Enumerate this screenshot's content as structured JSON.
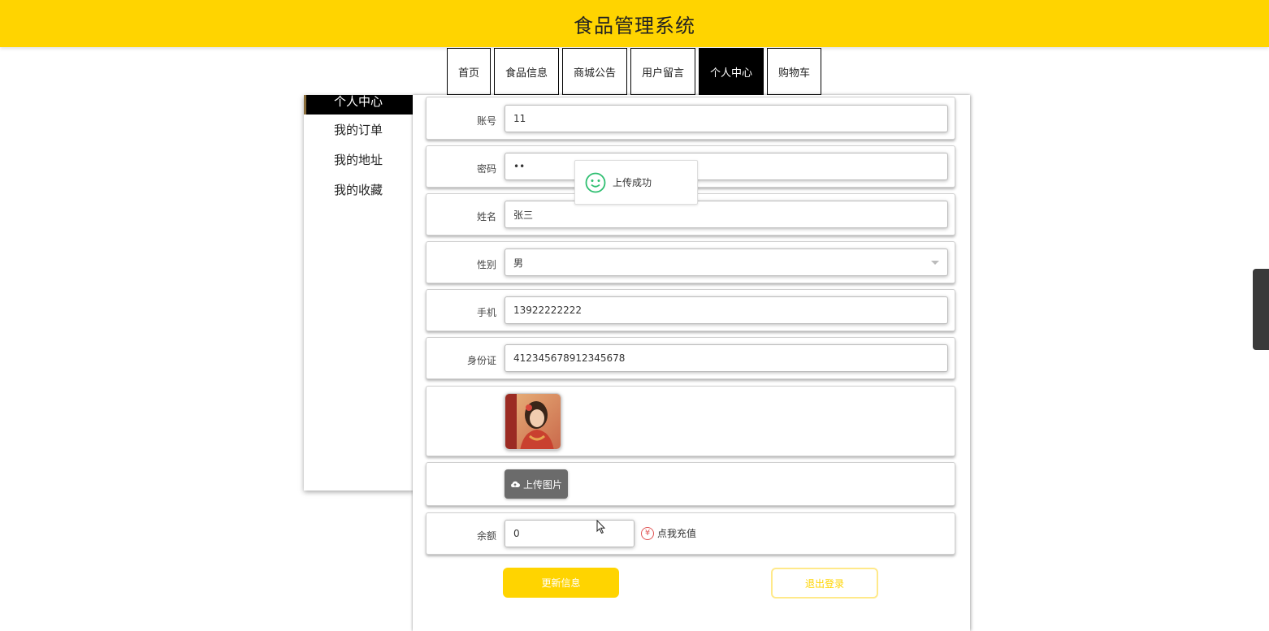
{
  "header": {
    "title": "食品管理系统",
    "bg_color": "#FFD400"
  },
  "nav": {
    "tabs": [
      {
        "label": "首页",
        "active": false
      },
      {
        "label": "食品信息",
        "active": false
      },
      {
        "label": "商城公告",
        "active": false
      },
      {
        "label": "用户留言",
        "active": false
      },
      {
        "label": "个人中心",
        "active": true
      },
      {
        "label": "购物车",
        "active": false
      }
    ]
  },
  "sidebar": {
    "items": [
      {
        "label": "个人中心",
        "active": true
      },
      {
        "label": "我的订单"
      },
      {
        "label": "我的地址"
      },
      {
        "label": "我的收藏"
      }
    ]
  },
  "form": {
    "account": {
      "label": "账号",
      "value": "11"
    },
    "password": {
      "label": "密码",
      "value": "••"
    },
    "name": {
      "label": "姓名",
      "value": "张三"
    },
    "gender": {
      "label": "性别",
      "value": "男"
    },
    "phone": {
      "label": "手机",
      "value": "13922222222"
    },
    "id_card": {
      "label": "身份证",
      "value": "412345678912345678"
    },
    "upload": {
      "label": "上传图片",
      "icon": "cloud-upload-icon"
    },
    "balance": {
      "label": "余额",
      "value": "0",
      "recharge_label": "点我充值",
      "recharge_icon": "¥"
    }
  },
  "actions": {
    "update_label": "更新信息",
    "logout_label": "退出登录",
    "accent": "#FFD400"
  },
  "toast": {
    "message": "上传成功",
    "icon": "smile-icon",
    "icon_color": "#2fbf71"
  }
}
